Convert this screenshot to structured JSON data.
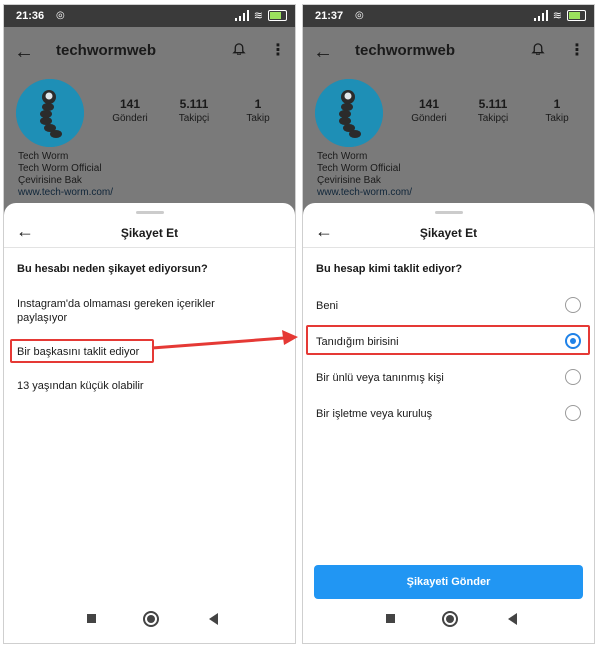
{
  "left": {
    "status": {
      "time": "21:36"
    },
    "profile": {
      "username": "techwormweb",
      "stats": [
        {
          "value": "141",
          "label": "Gönderi"
        },
        {
          "value": "5.111",
          "label": "Takipçi"
        },
        {
          "value": "1",
          "label": "Takip"
        }
      ],
      "bio": {
        "name": "Tech Worm",
        "line2": "Tech Worm Official",
        "translate": "Çevirisine Bak",
        "link": "www.tech-worm.com/"
      }
    },
    "sheet": {
      "title": "Şikayet Et",
      "question": "Bu hesabı neden şikayet ediyorsun?",
      "options": [
        "Instagram'da olmaması gereken içerikler paylaşıyor",
        "Bir başkasını taklit ediyor",
        "13 yaşından küçük olabilir"
      ],
      "highlighted_option": "Bir başkasını taklit ediyor"
    }
  },
  "right": {
    "status": {
      "time": "21:37"
    },
    "profile": {
      "username": "techwormweb",
      "stats": [
        {
          "value": "141",
          "label": "Gönderi"
        },
        {
          "value": "5.111",
          "label": "Takipçi"
        },
        {
          "value": "1",
          "label": "Takip"
        }
      ],
      "bio": {
        "name": "Tech Worm",
        "line2": "Tech Worm Official",
        "translate": "Çevirisine Bak",
        "link": "www.tech-worm.com/"
      }
    },
    "sheet": {
      "title": "Şikayet Et",
      "question": "Bu hesap kimi taklit ediyor?",
      "options": [
        {
          "label": "Beni",
          "selected": false
        },
        {
          "label": "Tanıdığım birisini",
          "selected": true
        },
        {
          "label": "Bir ünlü veya tanınmış kişi",
          "selected": false
        },
        {
          "label": "Bir işletme veya kuruluş",
          "selected": false
        }
      ],
      "submit_label": "Şikayeti Gönder"
    }
  },
  "colors": {
    "highlight": "#e53935",
    "accent": "#2196f3",
    "overlay": "#7a7a7a"
  },
  "icons": [
    "back-arrow-icon",
    "bell-icon",
    "more-vertical-icon",
    "radio-icon",
    "nav-square-icon",
    "nav-home-icon",
    "nav-back-icon"
  ]
}
